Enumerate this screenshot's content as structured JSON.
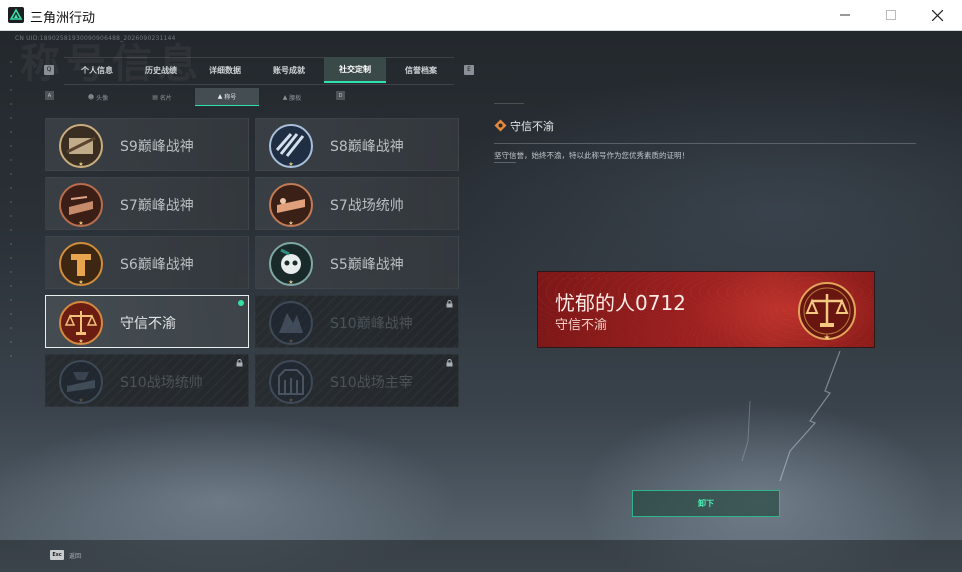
{
  "window": {
    "title": "三角洲行动",
    "controls": {
      "minimize": "minimize-icon",
      "maximize": "maximize-icon",
      "close": "close-icon"
    }
  },
  "game": {
    "uid": "CN UID:18902581930090906488_2026090231144",
    "background_text": "称号信息",
    "tabs": [
      {
        "label": "个人信息",
        "active": false
      },
      {
        "label": "历史战绩",
        "active": false
      },
      {
        "label": "详细数据",
        "active": false
      },
      {
        "label": "账号成就",
        "active": false
      },
      {
        "label": "社交定制",
        "active": true
      },
      {
        "label": "信誉档案",
        "active": false
      }
    ],
    "tab_arrows": {
      "prev": "Q",
      "next": "E"
    },
    "subtabs": [
      {
        "label": "头像",
        "icon": "person-icon",
        "active": false
      },
      {
        "label": "名片",
        "icon": "card-icon",
        "active": false
      },
      {
        "label": "称号",
        "icon": "title-icon",
        "active": true
      },
      {
        "label": "腰板",
        "icon": "plate-icon",
        "active": false
      }
    ],
    "subtab_arrows": {
      "prev": "A",
      "next": "D"
    },
    "titles": [
      {
        "label": "S9巅峰战神",
        "locked": false,
        "selected": false,
        "color": "#b49a6e"
      },
      {
        "label": "S8巅峰战神",
        "locked": false,
        "selected": false,
        "color": "#4e6f93"
      },
      {
        "label": "S7巅峰战神",
        "locked": false,
        "selected": false,
        "color": "#a8563a"
      },
      {
        "label": "S7战场统帅",
        "locked": false,
        "selected": false,
        "color": "#b06a44"
      },
      {
        "label": "S6巅峰战神",
        "locked": false,
        "selected": false,
        "color": "#c07a2c"
      },
      {
        "label": "S5巅峰战神",
        "locked": false,
        "selected": false,
        "color": "#3a6e6a"
      },
      {
        "label": "守信不渝",
        "locked": false,
        "selected": true,
        "color": "#c0441e"
      },
      {
        "label": "S10巅峰战神",
        "locked": true,
        "selected": false,
        "color": "#3c4a5e"
      },
      {
        "label": "S10战场统帅",
        "locked": true,
        "selected": false,
        "color": "#3c4a5e"
      },
      {
        "label": "S10战场主宰",
        "locked": true,
        "selected": false,
        "color": "#3c4a5e"
      }
    ],
    "detail": {
      "name": "守信不渝",
      "description": "坚守信誉，始终不渝，特以此称号作为您优秀素质的证明！"
    },
    "nameplate": {
      "player_name": "忧郁的人0712",
      "title": "守信不渝",
      "dots": "· · · · · · · · ·",
      "badge_icon": "scales-icon"
    },
    "equip_button": {
      "label": "卸下",
      "color": "#2fe3b0"
    },
    "bottom": {
      "key": "Esc",
      "label": "返回"
    }
  }
}
